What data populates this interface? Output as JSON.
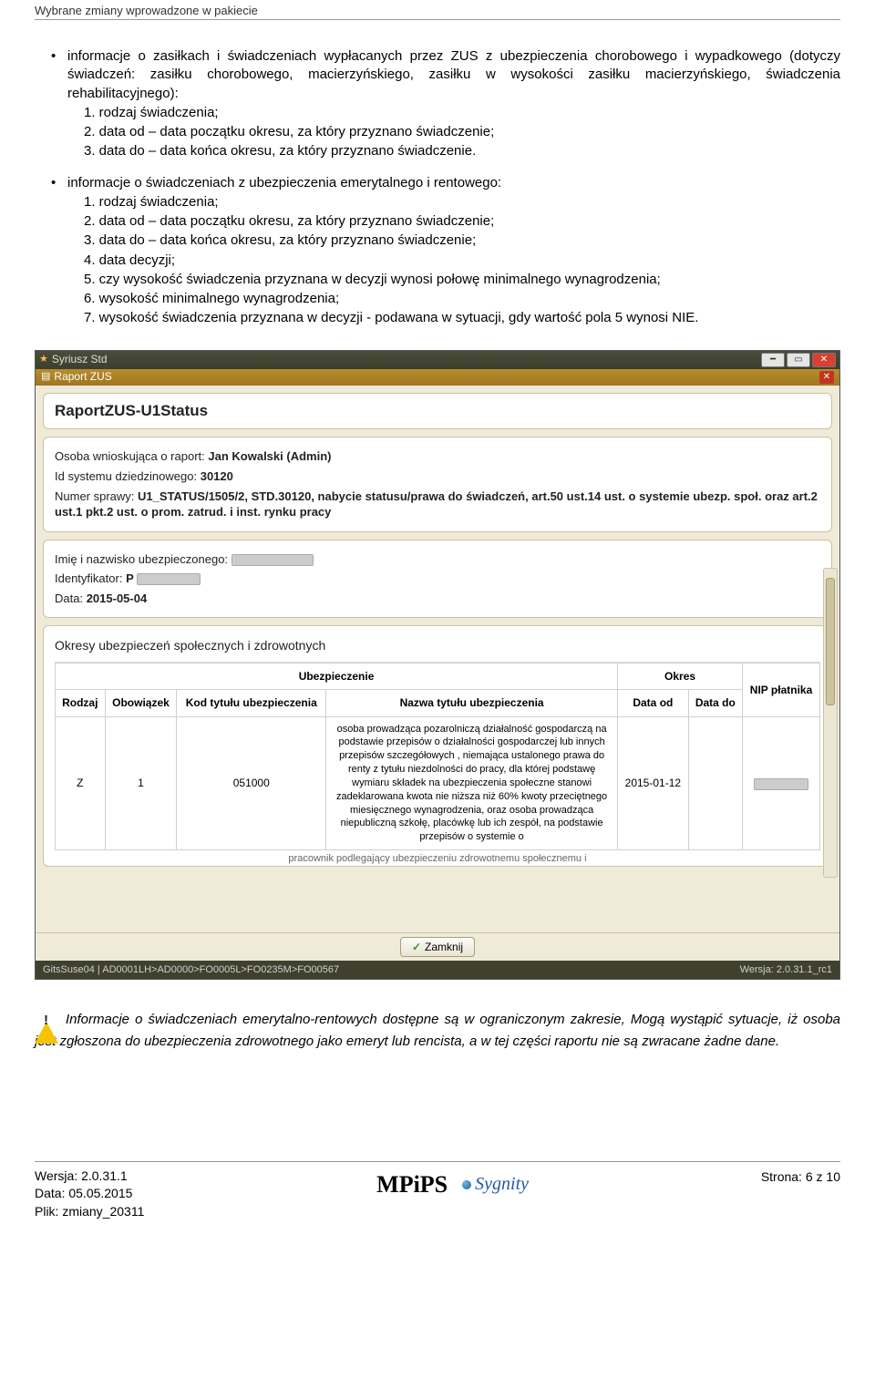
{
  "header": {
    "title": "Wybrane zmiany wprowadzone w pakiecie"
  },
  "bullet1": {
    "intro": "informacje o zasiłkach i świadczeniach wypłacanych przez ZUS z ubezpieczenia chorobowego i wypadkowego (dotyczy świadczeń: zasiłku chorobowego, macierzyńskiego, zasiłku w wysokości zasiłku macierzyńskiego, świadczenia rehabilitacyjnego):",
    "items": [
      "1. rodzaj świadczenia;",
      "2. data od – data początku okresu, za który przyznano świadczenie;",
      "3. data do – data końca okresu, za który przyznano świadczenie."
    ]
  },
  "bullet2": {
    "intro": "informacje o świadczeniach z ubezpieczenia emerytalnego i rentowego:",
    "items": [
      "1. rodzaj świadczenia;",
      "2. data od – data początku okresu, za który przyznano świadczenie;",
      "3. data do – data końca okresu, za który przyznano świadczenie;",
      "4. data decyzji;",
      "5. czy wysokość świadczenia przyznana w decyzji wynosi połowę minimalnego wynagrodzenia;",
      "6. wysokość minimalnego wynagrodzenia;",
      "7. wysokość świadczenia przyznana w decyzji - podawana w sytuacji, gdy wartość pola 5 wynosi NIE."
    ]
  },
  "app": {
    "winTitle": "Syriusz Std",
    "subTitle": "Raport ZUS",
    "reportTitle": "RaportZUS-U1Status",
    "req": {
      "osobaLabel": "Osoba wnioskująca o raport:",
      "osobaValue": "Jan Kowalski (Admin)",
      "idLabel": "Id systemu dziedzinowego:",
      "idValue": "30120",
      "numerLabel": "Numer sprawy:",
      "numerValue": "U1_STATUS/1505/2, STD.30120, nabycie statusu/prawa do świadczeń, art.50 ust.14 ust. o systemie ubezp. społ. oraz art.2 ust.1 pkt.2 ust. o prom. zatrud. i inst. rynku pracy"
    },
    "person": {
      "nameLabel": "Imię i nazwisko ubezpieczonego:",
      "idLabel": "Identyfikator:",
      "idPrefix": "P",
      "dateLabel": "Data:",
      "dateValue": "2015-05-04"
    },
    "tableTitle": "Okresy ubezpieczeń społecznych i zdrowotnych",
    "table": {
      "h_ubez": "Ubezpieczenie",
      "h_okres": "Okres",
      "h_nip": "NIP płatnika",
      "h_rodzaj": "Rodzaj",
      "h_obow": "Obowiązek",
      "h_kod": "Kod tytułu ubezpieczenia",
      "h_nazwa": "Nazwa tytułu ubezpieczenia",
      "h_dataod": "Data od",
      "h_datado": "Data do",
      "row1": {
        "rodzaj": "Z",
        "obow": "1",
        "kod": "051000",
        "nazwa": "osoba prowadząca pozarolniczą działalność gospodarczą na podstawie przepisów o działalności gospodarczej lub innych przepisów szczegółowych , niemająca ustalonego prawa do renty z tytułu niezdolności do pracy, dla której podstawę wymiaru składek na ubezpieczenia społeczne stanowi zadeklarowana kwota nie niższa niż 60% kwoty przeciętnego miesięcznego wynagrodzenia, oraz osoba prowadząca niepubliczną szkołę, placówkę lub ich zespół, na podstawie przepisów o systemie o",
        "dataod": "2015-01-12"
      },
      "truncated": "pracownik podlegający ubezpieczeniu zdrowotnemu społecznemu i"
    },
    "zamknij": "Zamknij",
    "statusLeft": "GitsSuse04 | AD0001LH>AD0000>FO0005L>FO0235M>FO00567",
    "statusRight": "Wersja: 2.0.31.1_rc1"
  },
  "note": "Informacje o świadczeniach emerytalno-rentowych dostępne są w ograniczonym zakresie, Mogą wystąpić sytuacje, iż osoba jest zgłoszona do ubezpieczenia zdrowotnego jako emeryt lub rencista, a w tej części raportu nie są zwracane żadne dane.",
  "footer": {
    "wersja": "Wersja: 2.0.31.1",
    "data": "Data: 05.05.2015",
    "plik": "Plik: zmiany_20311",
    "mpips": "MPiPS",
    "sygnity": "Sygnity",
    "strona": "Strona: 6 z 10"
  }
}
